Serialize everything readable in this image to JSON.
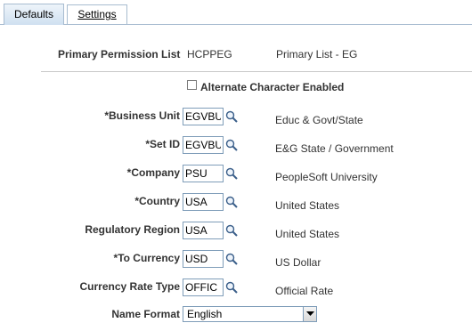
{
  "tabs": [
    {
      "label": "Defaults",
      "active": true
    },
    {
      "label": "Settings",
      "active": false
    }
  ],
  "header": {
    "permission_label": "Primary Permission List",
    "permission_value": "HCPPEG",
    "permission_desc": "Primary List - EG"
  },
  "alternate_char": {
    "label": "Alternate Character Enabled",
    "checked": false
  },
  "fields": [
    {
      "label": "*Business Unit",
      "value": "EGVBU",
      "desc": "Educ & Govt/State"
    },
    {
      "label": "*Set ID",
      "value": "EGVBU",
      "desc": "E&G State / Government"
    },
    {
      "label": "*Company",
      "value": "PSU",
      "desc": "PeopleSoft University"
    },
    {
      "label": "*Country",
      "value": "USA",
      "desc": "United States"
    },
    {
      "label": "Regulatory Region",
      "value": "USA",
      "desc": "United States"
    },
    {
      "label": "*To Currency",
      "value": "USD",
      "desc": "US Dollar"
    },
    {
      "label": "Currency Rate Type",
      "value": "OFFIC",
      "desc": "Official Rate"
    }
  ],
  "name_format": {
    "label": "Name Format",
    "selected": "English"
  },
  "icons": {
    "lookup": "magnifier-icon",
    "dropdown": "chevron-down-icon"
  },
  "colors": {
    "tab_border": "#a8bcd0",
    "field_border": "#7f9db9"
  }
}
